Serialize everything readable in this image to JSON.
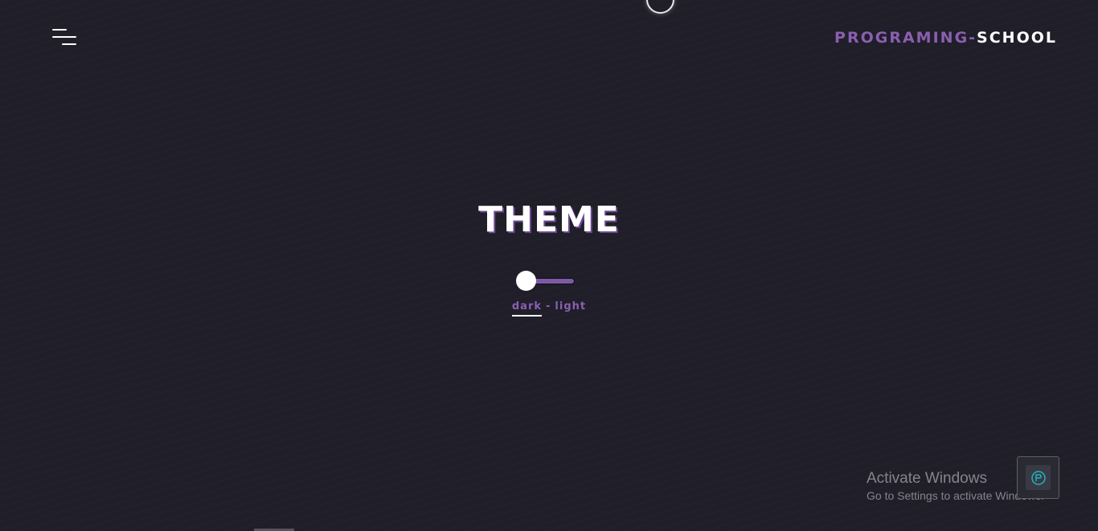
{
  "header": {
    "menu_icon": "hamburger-menu-icon",
    "brand_accent": "PROGRAMING-",
    "brand_main": "SCHOOL"
  },
  "theme": {
    "title": "THEME",
    "toggle_state": "dark",
    "option_dark": "dark",
    "separator": "-",
    "option_light": "light"
  },
  "watermark": {
    "line1": "Activate Windows",
    "line2": "Go to Settings to activate Windows."
  },
  "badge": {
    "icon": "app-badge-icon"
  },
  "colors": {
    "background": "#1f1e29",
    "accent": "#8a5fb0",
    "text": "#ffffff"
  }
}
